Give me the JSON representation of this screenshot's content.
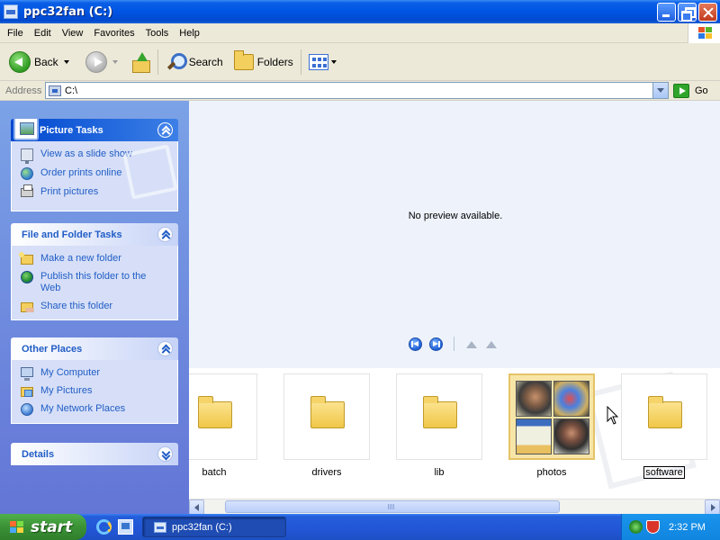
{
  "window": {
    "title": "ppc32fan (C:)"
  },
  "menu": [
    "File",
    "Edit",
    "View",
    "Favorites",
    "Tools",
    "Help"
  ],
  "toolbar": {
    "back": "Back",
    "search": "Search",
    "folders": "Folders"
  },
  "address": {
    "label": "Address",
    "value": "C:\\",
    "go": "Go"
  },
  "task_pane": {
    "picture_tasks": {
      "title": "Picture Tasks",
      "items": [
        "View as a slide show",
        "Order prints online",
        "Print pictures"
      ]
    },
    "file_folder_tasks": {
      "title": "File and Folder Tasks",
      "items": [
        "Make a new folder",
        "Publish this folder to the Web",
        "Share this folder"
      ]
    },
    "other_places": {
      "title": "Other Places",
      "items": [
        "My Computer",
        "My Pictures",
        "My Network Places"
      ]
    },
    "details": {
      "title": "Details"
    }
  },
  "preview": {
    "message": "No preview available."
  },
  "filmstrip": {
    "items": [
      {
        "label": "batch",
        "type": "folder"
      },
      {
        "label": "drivers",
        "type": "folder"
      },
      {
        "label": "lib",
        "type": "folder"
      },
      {
        "label": "photos",
        "type": "photo-folder",
        "selected": true
      },
      {
        "label": "software",
        "type": "folder",
        "editing": true
      }
    ]
  },
  "taskbar": {
    "start": "start",
    "task_button": "ppc32fan (C:)",
    "clock": "2:32 PM"
  },
  "colors": {
    "titlebar": "#0054e3",
    "taskpane_gradient_top": "#7ba2e7",
    "taskpane_gradient_bottom": "#6375d6",
    "link": "#215dc6",
    "preview_bg": "#eef3fb",
    "start_green": "#3b9236"
  }
}
